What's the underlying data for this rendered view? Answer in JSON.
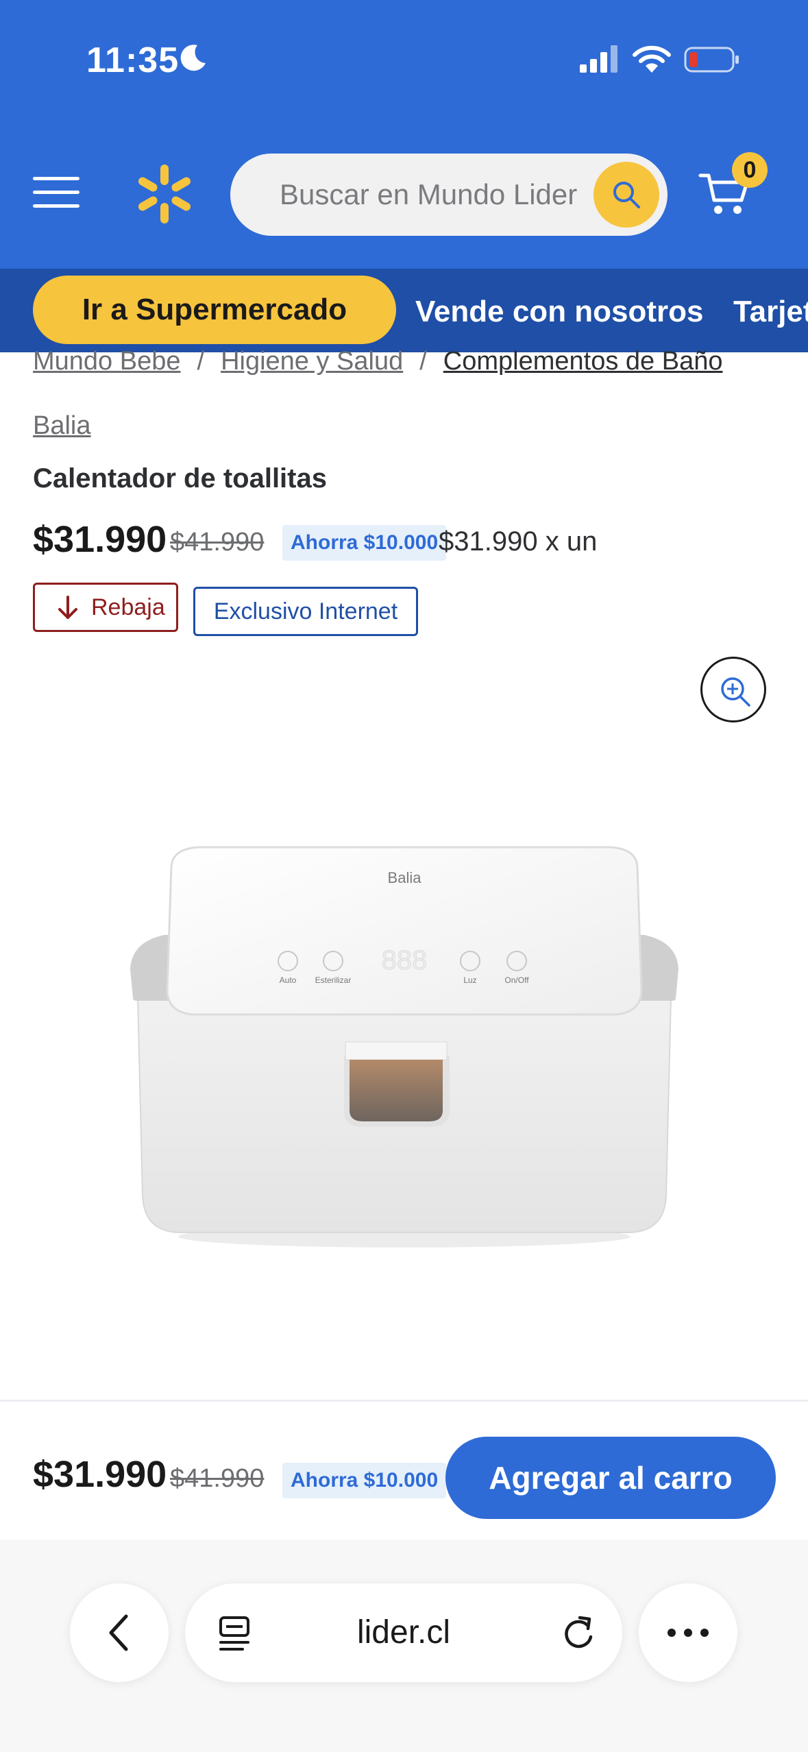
{
  "status_bar": {
    "time": "11:35"
  },
  "header": {
    "search_placeholder": "Buscar en Mundo Lider",
    "cart_count": "0",
    "colors": {
      "header_blue": "#2e6bd6",
      "accent_yellow": "#f7c43e",
      "nav_blue": "#1f4fa6"
    },
    "icons": [
      "menu-icon",
      "spark-logo-icon",
      "search-icon",
      "cart-icon"
    ]
  },
  "subnav": {
    "primary": "Ir a Supermercado",
    "links": [
      "Vende con nosotros",
      "Tarjeta"
    ]
  },
  "breadcrumb": [
    "Mundo Bebe",
    "Higiene y Salud",
    "Complementos de Baño"
  ],
  "product": {
    "brand": "Balia",
    "title": "Calentador de toallitas",
    "price": "$31.990",
    "old_price": "$41.990",
    "savings": "Ahorra $10.000",
    "unit_price": "$31.990 x un",
    "tags": {
      "rebaja": "Rebaja",
      "exclusivo": "Exclusivo Internet"
    },
    "image": {
      "logo": "Balia",
      "buttons": [
        "Auto",
        "Esterilizar",
        "Luz",
        "On/Off"
      ],
      "display": "888"
    }
  },
  "bottom_bar": {
    "price": "$31.990",
    "old_price": "$41.990",
    "savings": "Ahorra $10.000",
    "add_button": "Agregar al carro"
  },
  "browser": {
    "url": "lider.cl"
  }
}
